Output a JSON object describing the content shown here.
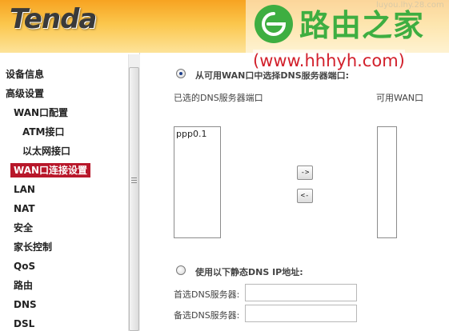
{
  "header": {
    "brand": "Tenda",
    "watermark_title": "路由之家",
    "watermark_faint": "luyou.lhy.28.com",
    "watermark_url": "(www.hhhyh.com)"
  },
  "sidebar": {
    "items": [
      {
        "label": "设备信息"
      },
      {
        "label": "高级设置"
      },
      {
        "label": "WAN口配置"
      },
      {
        "label": "ATM接口"
      },
      {
        "label": "以太网接口"
      },
      {
        "label": "WAN口连接设置"
      },
      {
        "label": "LAN"
      },
      {
        "label": "NAT"
      },
      {
        "label": "安全"
      },
      {
        "label": "家长控制"
      },
      {
        "label": "QoS"
      },
      {
        "label": "路由"
      },
      {
        "label": "DNS"
      },
      {
        "label": "DSL"
      }
    ]
  },
  "dns": {
    "option_wan_label": "从可用WAN口中选择DNS服务器端口:",
    "option_static_label": "使用以下静态DNS IP地址:",
    "selected_list_label": "已选的DNS服务器端口",
    "available_list_label": "可用WAN口",
    "selected_items": [
      "ppp0.1"
    ],
    "available_items": [],
    "move_right_label": "->",
    "move_left_label": "<-",
    "primary_label": "首选DNS服务器:",
    "secondary_label": "备选DNS服务器:",
    "primary_value": "",
    "secondary_value": ""
  },
  "colors": {
    "header_orange": "#f7a321",
    "active_menu": "#b8172a",
    "watermark_green": "#3eae41",
    "watermark_red": "#d2202b"
  }
}
